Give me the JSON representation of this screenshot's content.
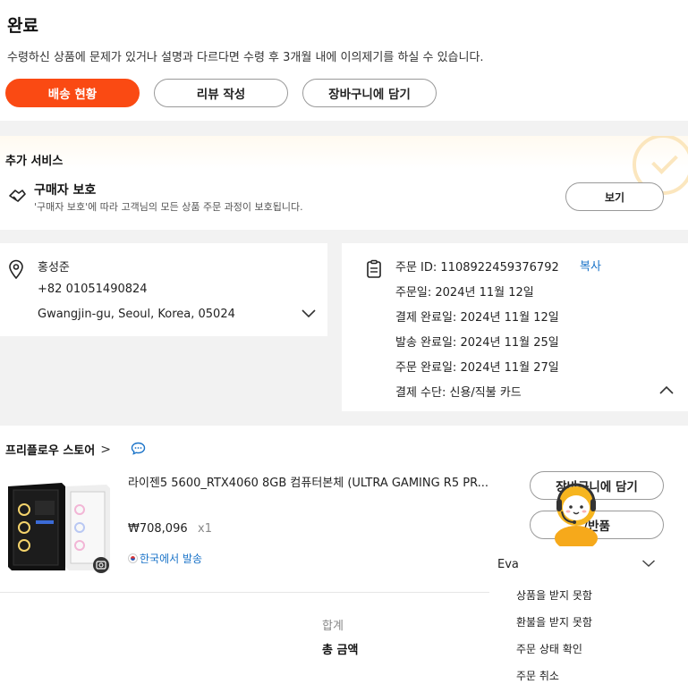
{
  "status": {
    "title": "완료",
    "description": "수령하신 상품에 문제가 있거나 설명과 다르다면 수령 후 3개월 내에 이의제기를 하실 수 있습니다.",
    "buttons": {
      "delivery": "배송 현황",
      "review": "리뷰 작성",
      "cart": "장바구니에 담기"
    },
    "accent_color": "#fa4a13"
  },
  "services": {
    "header": "추가 서비스",
    "buyer_protection": {
      "title": "구매자 보호",
      "description": "'구매자 보호'에 따라 고객님의 모든 상품 주문 과정이 보호됩니다.",
      "button": "보기"
    }
  },
  "address": {
    "name": "홍성준",
    "phone": "+82 01051490824",
    "location": "Gwangjin-gu, Seoul, Korea, 05024"
  },
  "order": {
    "id_line": "주문 ID: 1108922459376792",
    "copy": "복사",
    "order_date": "주문일: 2024년 11월 12일",
    "payment_done": "결제 완료일: 2024년 11월 12일",
    "shipped": "발송 완료일: 2024년 11월 25일",
    "completed": "주문 완료일: 2024년 11월 27일",
    "payment_method": "결제 수단: 신용/직불 카드"
  },
  "store": {
    "name": "프리플로우 스토어",
    "chevron": ">",
    "product": {
      "title": "라이젠5 5600_RTX4060 8GB 컴퓨터본체 (ULTRA GAMING R5 PR...",
      "price": "₩708,096",
      "quantity": "x1",
      "ship_from": "한국에서 발송"
    },
    "buttons": {
      "cart": "장바구니에 담기",
      "return": "/반품"
    },
    "total_label": "합계",
    "total_amount_label": "총 금액"
  },
  "assistant": {
    "name": "Eva",
    "items": [
      "상품을 받지 못함",
      "환불을 받지 못함",
      "주문 상태 확인",
      "주문 취소"
    ]
  },
  "icons": [
    "shield-check-icon",
    "location-pin-icon",
    "chevron-down-icon",
    "document-icon",
    "chevron-up-icon",
    "chat-bubble-icon",
    "camera-icon"
  ]
}
